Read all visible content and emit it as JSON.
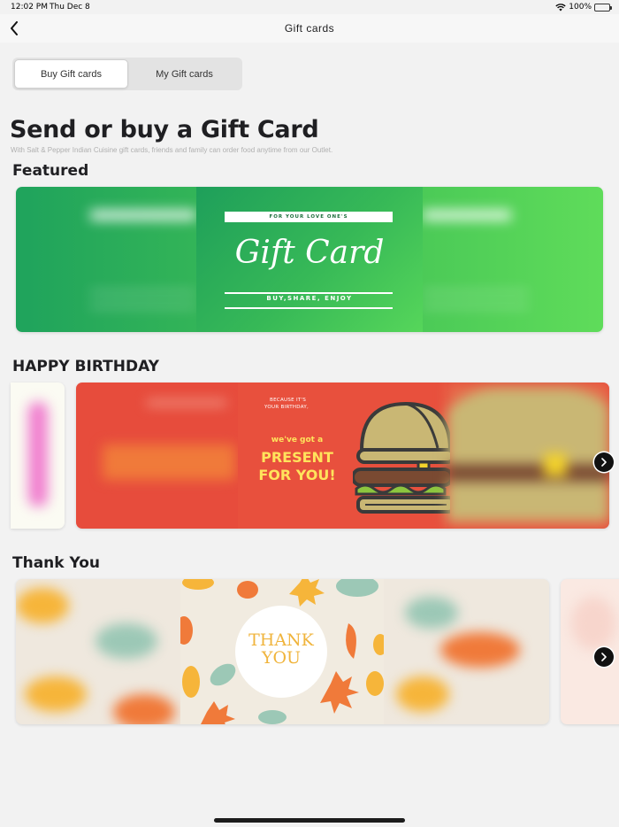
{
  "status_bar": {
    "time": "12:02 PM",
    "date": "Thu Dec 8",
    "battery": "100%"
  },
  "nav": {
    "title": "Gift cards",
    "back_icon": "chevron-left-icon"
  },
  "segments": [
    {
      "label": "Buy Gift cards",
      "active": true
    },
    {
      "label": "My Gift cards",
      "active": false
    }
  ],
  "headline": "Send or buy a Gift Card",
  "subline": "With Salt & Pepper Indian Cuisine gift cards, friends and family can order food anytime from our Outlet.",
  "sections": {
    "featured": {
      "title": "Featured",
      "card": {
        "top_text": "FOR YOUR LOVE ONE'S",
        "script_text": "Gift Card",
        "tagline": "BUY,SHARE, ENJOY",
        "colors": {
          "start": "#1fa35c",
          "end": "#5fdc5a"
        }
      }
    },
    "birthday": {
      "title": "HAPPY BIRTHDAY",
      "card": {
        "small_line_1": "BECAUSE IT'S",
        "small_line_2": "YOUR BIRTHDAY,",
        "got_text": "we've got a",
        "present_line_1": "PRESENT",
        "present_line_2": "FOR YOU!",
        "colors": {
          "background": "#e74c3c",
          "accent": "#ffe35c"
        }
      }
    },
    "thankyou": {
      "title": "Thank You",
      "card": {
        "line_1": "THANK",
        "line_2": "YOU",
        "colors": {
          "background": "#efe8de",
          "text": "#f0b43c"
        }
      }
    }
  },
  "next_icon": "chevron-right-icon"
}
